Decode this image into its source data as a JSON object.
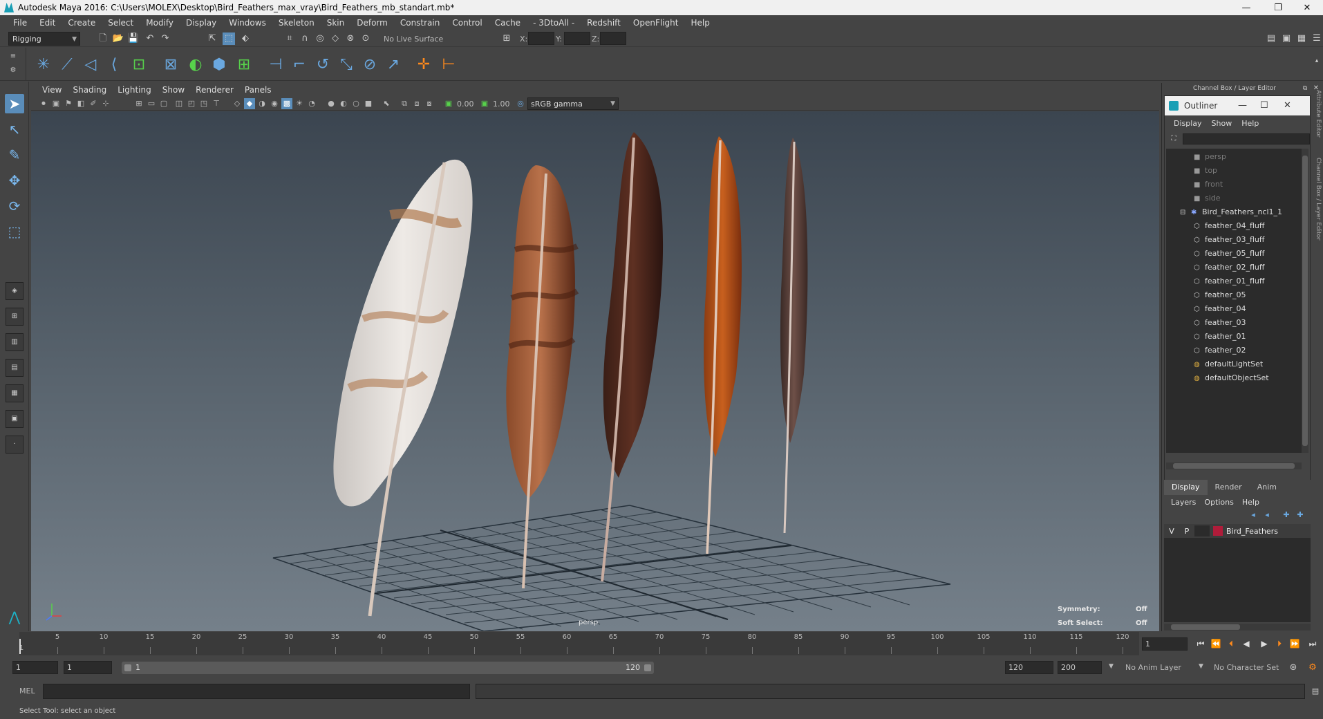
{
  "window": {
    "title": "Autodesk Maya 2016: C:\\Users\\MOLEX\\Desktop\\Bird_Feathers_max_vray\\Bird_Feathers_mb_standart.mb*",
    "minimize": "—",
    "restore": "❐",
    "close": "✕"
  },
  "menus": [
    "File",
    "Edit",
    "Create",
    "Select",
    "Modify",
    "Display",
    "Windows",
    "Skeleton",
    "Skin",
    "Deform",
    "Constrain",
    "Control",
    "Cache",
    "- 3DtoAll -",
    "Redshift",
    "OpenFlight",
    "Help"
  ],
  "statusline": {
    "menu_set": "Rigging",
    "live_surface": "No Live Surface",
    "x_label": "X:",
    "y_label": "Y:",
    "z_label": "Z:"
  },
  "viewport": {
    "menus": [
      "View",
      "Shading",
      "Lighting",
      "Show",
      "Renderer",
      "Panels"
    ],
    "exposure": "0.00",
    "gamma": "1.00",
    "color_space": "sRGB gamma",
    "camera_label": "persp",
    "hud": {
      "symmetry_label": "Symmetry:",
      "symmetry_value": "Off",
      "soft_select_label": "Soft Select:",
      "soft_select_value": "Off"
    }
  },
  "right_panel": {
    "title": "Channel Box / Layer Editor",
    "side_tab_attr": "Attribute Editor",
    "side_tab_cb": "Channel Box / Layer Editor"
  },
  "outliner": {
    "title": "Outliner",
    "menus": [
      "Display",
      "Show",
      "Help"
    ],
    "items": [
      {
        "label": "persp",
        "type": "camera"
      },
      {
        "label": "top",
        "type": "camera"
      },
      {
        "label": "front",
        "type": "camera"
      },
      {
        "label": "side",
        "type": "camera"
      },
      {
        "label": "Bird_Feathers_ncl1_1",
        "type": "group"
      },
      {
        "label": "feather_04_fluff",
        "type": "mesh"
      },
      {
        "label": "feather_03_fluff",
        "type": "mesh"
      },
      {
        "label": "feather_05_fluff",
        "type": "mesh"
      },
      {
        "label": "feather_02_fluff",
        "type": "mesh"
      },
      {
        "label": "feather_01_fluff",
        "type": "mesh"
      },
      {
        "label": "feather_05",
        "type": "mesh"
      },
      {
        "label": "feather_04",
        "type": "mesh"
      },
      {
        "label": "feather_03",
        "type": "mesh"
      },
      {
        "label": "feather_01",
        "type": "mesh"
      },
      {
        "label": "feather_02",
        "type": "mesh"
      },
      {
        "label": "defaultLightSet",
        "type": "set"
      },
      {
        "label": "defaultObjectSet",
        "type": "set"
      }
    ]
  },
  "layer_editor": {
    "tabs": [
      "Display",
      "Render",
      "Anim"
    ],
    "menus": [
      "Layers",
      "Options",
      "Help"
    ],
    "layers": [
      {
        "v": "V",
        "p": "P",
        "name": "Bird_Feathers",
        "color": "#b01c3a"
      }
    ]
  },
  "timeslider": {
    "ticks": [
      "5",
      "10",
      "15",
      "20",
      "25",
      "30",
      "35",
      "40",
      "45",
      "50",
      "55",
      "60",
      "65",
      "70",
      "75",
      "80",
      "85",
      "90",
      "95",
      "100",
      "105",
      "110",
      "115",
      "120"
    ],
    "first_tick": "1",
    "current_frame": "1"
  },
  "range": {
    "start": "1",
    "playback_start": "1",
    "slider_start": "1",
    "slider_end": "120",
    "playback_end": "120",
    "end": "200",
    "anim_layer": "No Anim Layer",
    "character_set": "No Character Set"
  },
  "cmdline": {
    "label": "MEL"
  },
  "help": {
    "text": "Select Tool: select an object"
  },
  "colors": {
    "selected_tool": "#5a8dba",
    "layer_color": "#b01c3a",
    "shelf_blue": "#6aa8e0",
    "shelf_green": "#57d14b",
    "shelf_orange": "#ff8a1c"
  }
}
